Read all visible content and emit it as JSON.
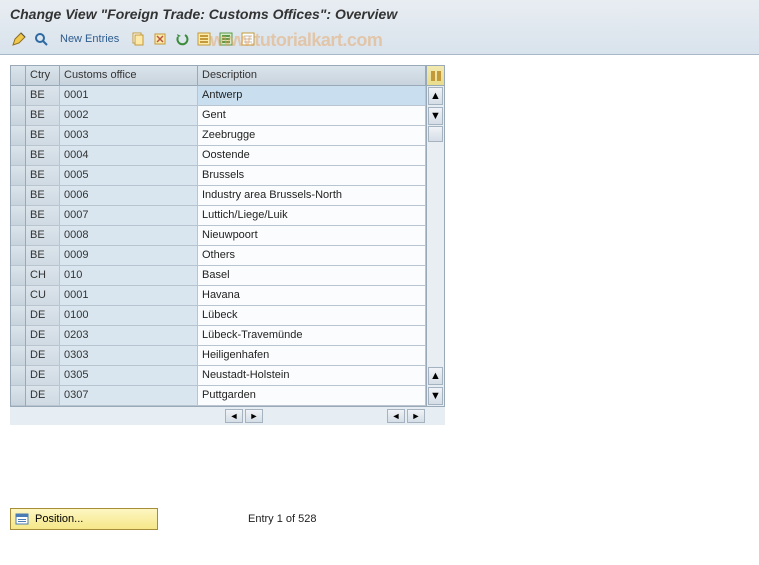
{
  "header": {
    "title": "Change View \"Foreign Trade: Customs Offices\": Overview"
  },
  "toolbar": {
    "newEntriesLabel": "New Entries"
  },
  "watermark": "www.tutorialkart.com",
  "grid": {
    "columns": {
      "ctry": "Ctry",
      "office": "Customs office",
      "desc": "Description"
    },
    "rows": [
      {
        "ctry": "BE",
        "office": "0001",
        "desc": "Antwerp",
        "selected": true
      },
      {
        "ctry": "BE",
        "office": "0002",
        "desc": "Gent"
      },
      {
        "ctry": "BE",
        "office": "0003",
        "desc": "Zeebrugge"
      },
      {
        "ctry": "BE",
        "office": "0004",
        "desc": "Oostende"
      },
      {
        "ctry": "BE",
        "office": "0005",
        "desc": "Brussels"
      },
      {
        "ctry": "BE",
        "office": "0006",
        "desc": "Industry area Brussels-North"
      },
      {
        "ctry": "BE",
        "office": "0007",
        "desc": "Luttich/Liege/Luik"
      },
      {
        "ctry": "BE",
        "office": "0008",
        "desc": "Nieuwpoort"
      },
      {
        "ctry": "BE",
        "office": "0009",
        "desc": "Others"
      },
      {
        "ctry": "CH",
        "office": "010",
        "desc": "Basel"
      },
      {
        "ctry": "CU",
        "office": "0001",
        "desc": "Havana"
      },
      {
        "ctry": "DE",
        "office": "0100",
        "desc": "Lübeck"
      },
      {
        "ctry": "DE",
        "office": "0203",
        "desc": "Lübeck-Travemünde"
      },
      {
        "ctry": "DE",
        "office": "0303",
        "desc": "Heiligenhafen"
      },
      {
        "ctry": "DE",
        "office": "0305",
        "desc": "Neustadt-Holstein"
      },
      {
        "ctry": "DE",
        "office": "0307",
        "desc": "Puttgarden"
      }
    ]
  },
  "footer": {
    "positionLabel": "Position...",
    "entryStatus": "Entry 1 of 528"
  }
}
